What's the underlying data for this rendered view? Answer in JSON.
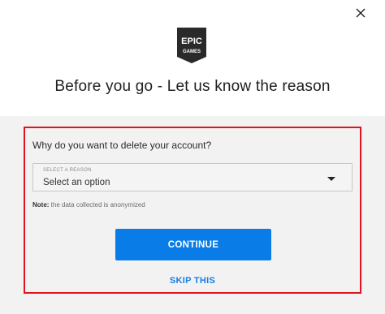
{
  "logo": {
    "line1": "EPIC",
    "line2": "GAMES"
  },
  "dialog": {
    "title": "Before you go - Let us know the reason",
    "question": "Why do you want to delete your account?",
    "select": {
      "label": "SELECT A REASON",
      "value": "Select an option"
    },
    "note": {
      "prefix": "Note:",
      "text": " the data collected is anonymized"
    },
    "continue_label": "CONTINUE",
    "skip_label": "SKIP THIS"
  },
  "colors": {
    "accent": "#0a7ce8",
    "highlight_border": "#e0141e",
    "panel_bg": "#f2f2f2"
  },
  "icons": {
    "close": "close-icon",
    "dropdown": "chevron-down-icon"
  }
}
